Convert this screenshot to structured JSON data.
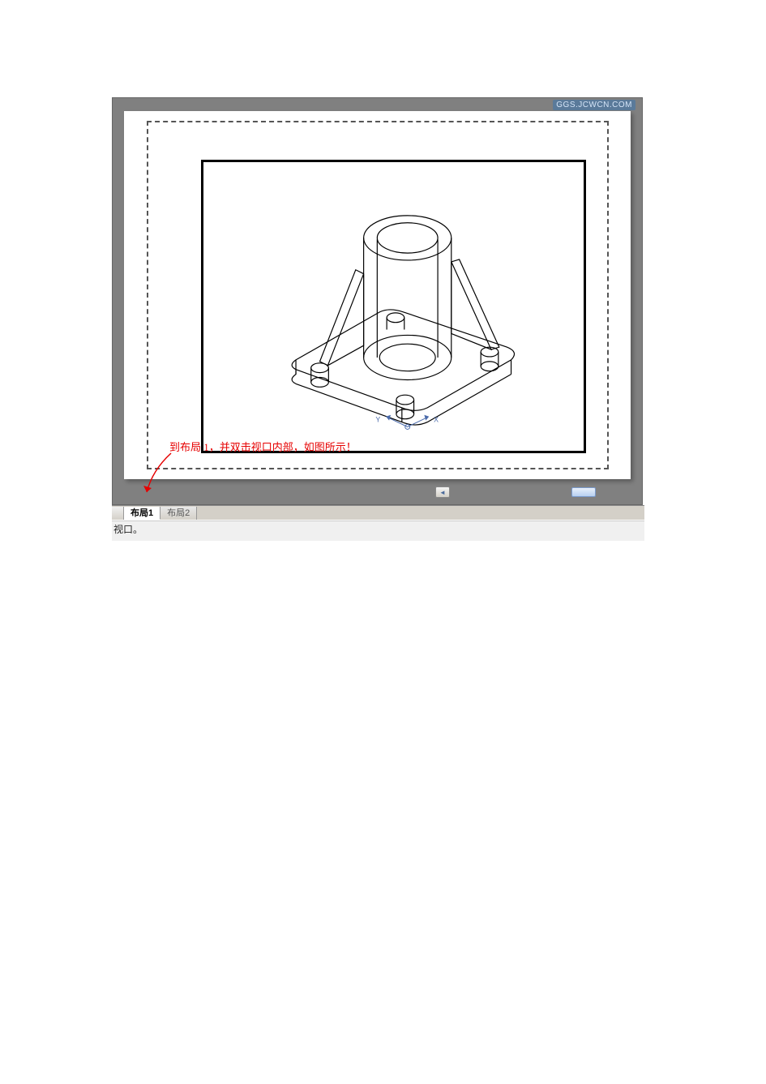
{
  "watermark": "GGS.JCWCN.COM",
  "annotation": "到布局 1，并双击视口内部，如图所示！",
  "tabs": {
    "active": "布局1",
    "inactive": "布局2"
  },
  "command_line": "视口。",
  "scroll": {
    "left_arrow": "◄"
  }
}
